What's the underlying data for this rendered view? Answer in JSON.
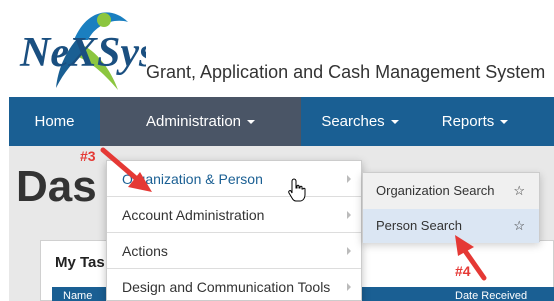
{
  "header": {
    "logo_text": "NeXSys",
    "app_title": "Grant, Application and Cash Management System"
  },
  "nav": {
    "home": "Home",
    "administration": "Administration",
    "searches": "Searches",
    "reports": "Reports"
  },
  "page": {
    "title": "Das",
    "panel_title": "My Tas",
    "table_headers": [
      "Name",
      "Date Received"
    ]
  },
  "admin_menu": {
    "items": [
      {
        "label": "Organization & Person"
      },
      {
        "label": "Account Administration"
      },
      {
        "label": "Actions"
      },
      {
        "label": "Design and Communication Tools"
      }
    ]
  },
  "submenu": {
    "items": [
      {
        "label": "Organization Search",
        "icon": "star-outline-icon"
      },
      {
        "label": "Person Search",
        "icon": "star-outline-icon"
      }
    ]
  },
  "annotations": {
    "step3": "#3",
    "step4": "#4"
  },
  "colors": {
    "nav_bg": "#1a5f93",
    "nav_active_bg": "#4a5566",
    "annotation": "#e53935",
    "link": "#1a5f93"
  }
}
